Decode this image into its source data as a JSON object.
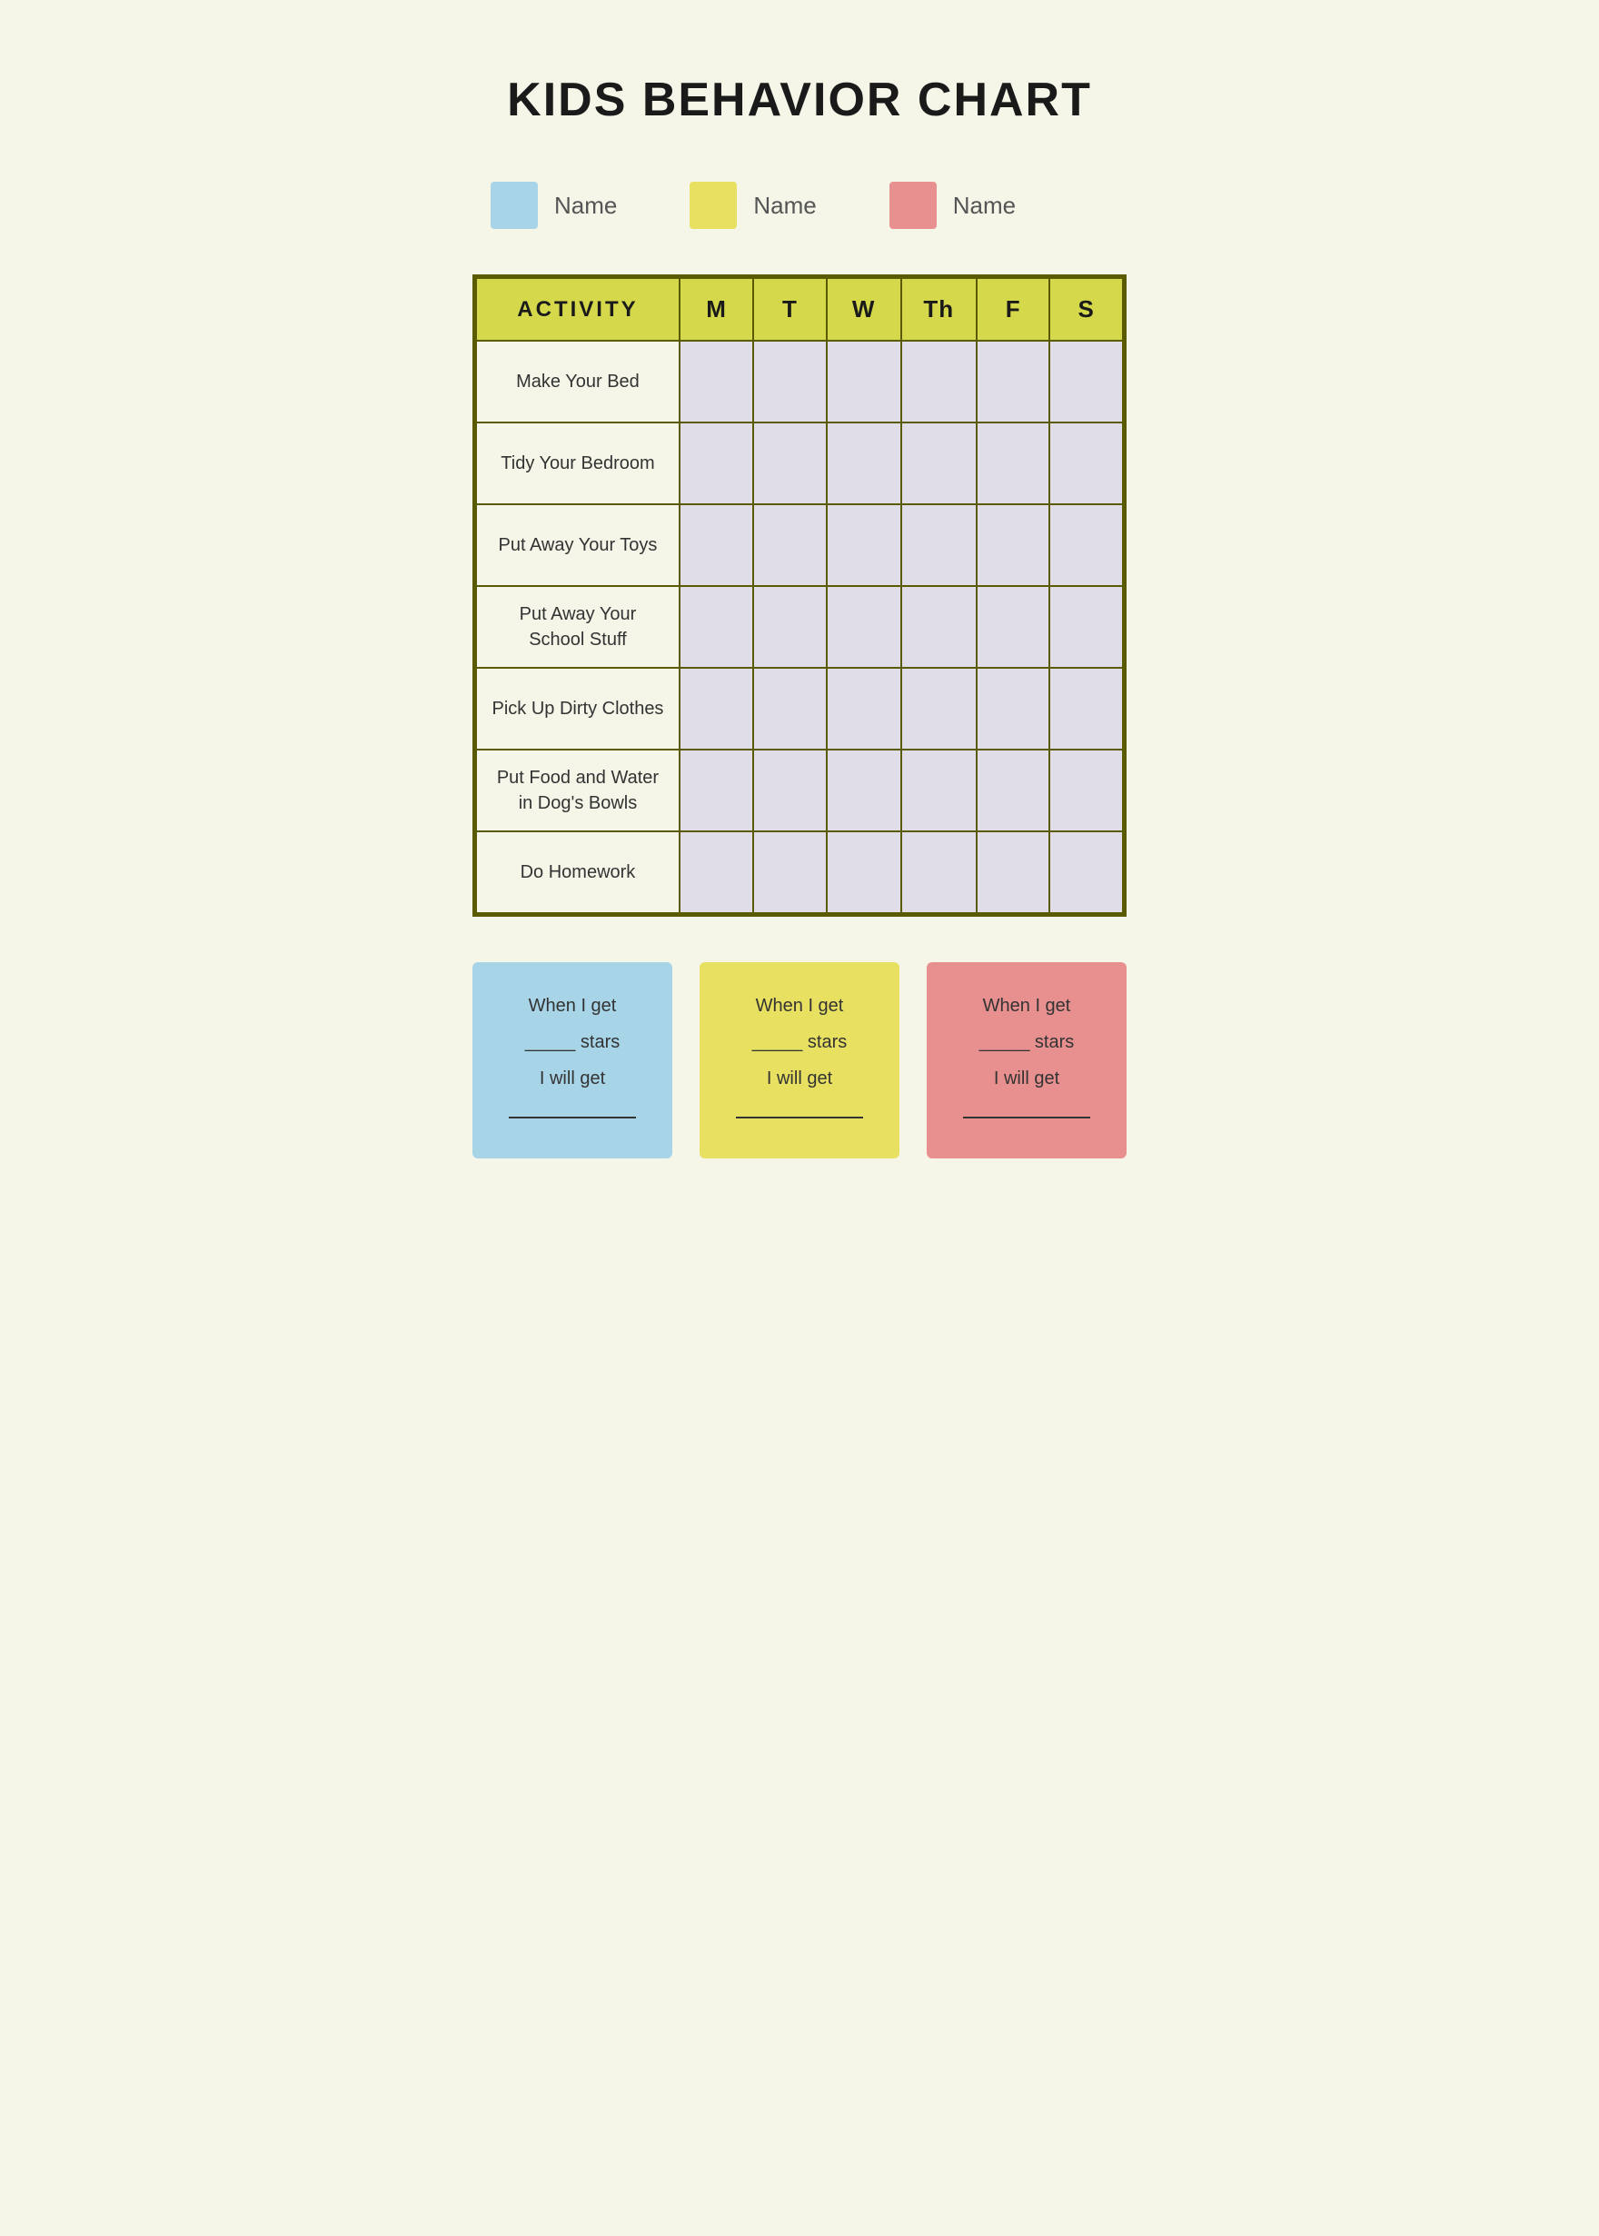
{
  "page": {
    "title": "KIDS BEHAVIOR CHART",
    "background_color": "#f5f5e8"
  },
  "legend": {
    "items": [
      {
        "color": "#a8d4e8",
        "label": "Name"
      },
      {
        "color": "#e8e060",
        "label": "Name"
      },
      {
        "color": "#e89090",
        "label": "Name"
      }
    ]
  },
  "table": {
    "header": {
      "activity_col": "ACTIVITY",
      "days": [
        "M",
        "T",
        "W",
        "Th",
        "F",
        "S"
      ]
    },
    "rows": [
      {
        "activity": "Make Your Bed"
      },
      {
        "activity": "Tidy Your Bedroom"
      },
      {
        "activity": "Put Away Your Toys"
      },
      {
        "activity": "Put Away Your School Stuff"
      },
      {
        "activity": "Pick Up Dirty Clothes"
      },
      {
        "activity": "Put Food and Water in Dog's Bowls"
      },
      {
        "activity": "Do Homework"
      }
    ]
  },
  "reward_boxes": [
    {
      "color": "#a8d4e8",
      "line1": "When I get",
      "line2": "_____ stars",
      "line3": "I will get",
      "line4": "_______________"
    },
    {
      "color": "#e8e060",
      "line1": "When I get",
      "line2": "_____ stars",
      "line3": "I will get",
      "line4": "_______________"
    },
    {
      "color": "#e89090",
      "line1": "When I get",
      "line2": "_____ stars",
      "line3": "I will get",
      "line4": "_______________"
    }
  ]
}
